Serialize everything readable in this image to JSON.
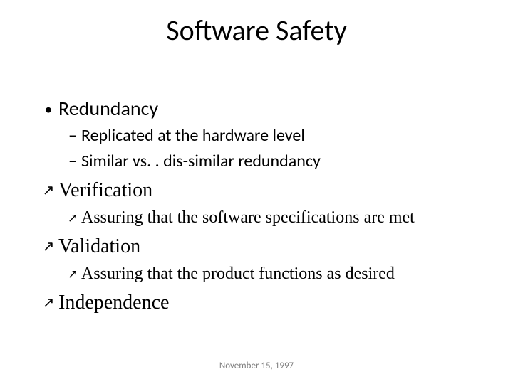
{
  "title": "Software Safety",
  "items": [
    {
      "level": "l1",
      "bullet": "•",
      "text": "Redundancy"
    },
    {
      "level": "l2",
      "bullet": "–",
      "text": "Replicated at the hardware level"
    },
    {
      "level": "l2",
      "bullet": "–",
      "text": "Similar vs. . dis-similar redundancy"
    },
    {
      "level": "a1",
      "bullet": "arrow",
      "text": "Verification"
    },
    {
      "level": "a2",
      "bullet": "arrow",
      "text": "Assuring that the software specifications are met"
    },
    {
      "level": "a1",
      "bullet": "arrow",
      "text": "Validation"
    },
    {
      "level": "a2",
      "bullet": "arrow",
      "text": "Assuring that the product functions as desired"
    },
    {
      "level": "a1",
      "bullet": "arrow",
      "text": "Independence"
    }
  ],
  "footer": "November 15, 1997"
}
